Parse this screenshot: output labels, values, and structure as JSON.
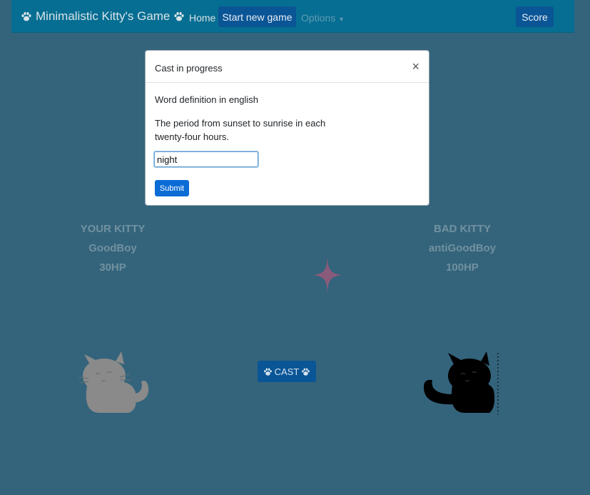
{
  "navbar": {
    "brand": "Minimalistic Kitty's Game",
    "home": "Home",
    "start_new_game": "Start new game",
    "options": "Options",
    "score": "Score"
  },
  "modal": {
    "title": "Cast in progress",
    "close": "×",
    "subtitle": "Word definition in english",
    "definition": "The period from sunset to sunrise in each twenty-four hours.",
    "input_value": "night",
    "submit": "Submit"
  },
  "player": {
    "heading": "YOUR KITTY",
    "name": "GoodBoy",
    "hp": "30HP"
  },
  "enemy": {
    "heading": "BAD KITTY",
    "name": "antiGoodBoy",
    "hp": "100HP"
  },
  "cast_button": "CAST",
  "colors": {
    "background": "#34647c",
    "navbar": "#066e92",
    "button": "#0a5596",
    "submit": "#0c6cd6",
    "sparkle": "#8a5a7a",
    "player_cat": "#8a8a8a",
    "enemy_cat": "#000000"
  },
  "icons": [
    "paw-icon",
    "close-icon",
    "caret-down-icon",
    "sparkle-icon",
    "cat-icon"
  ]
}
